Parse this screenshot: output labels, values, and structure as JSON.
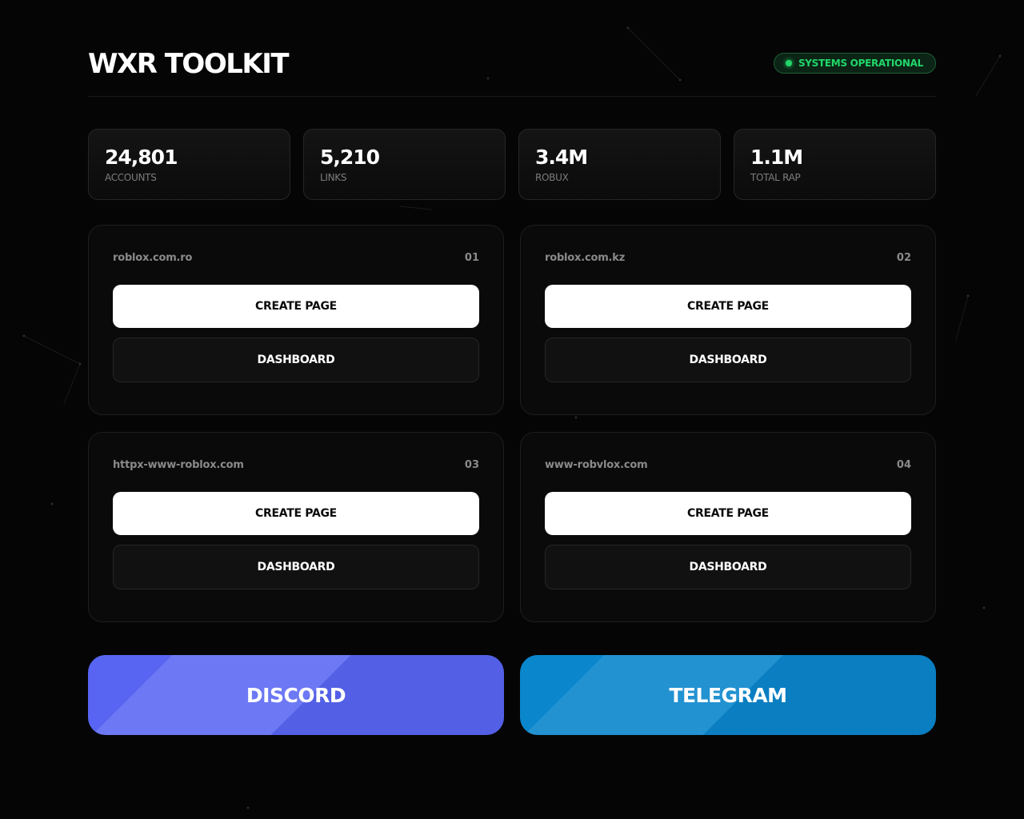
{
  "header": {
    "title": "WXR TOOLKIT",
    "status": "SYSTEMS OPERATIONAL"
  },
  "stats": [
    {
      "value": "24,801",
      "label": "ACCOUNTS"
    },
    {
      "value": "5,210",
      "label": "LINKS"
    },
    {
      "value": "3.4M",
      "label": "ROBUX"
    },
    {
      "value": "1.1M",
      "label": "TOTAL RAP"
    }
  ],
  "domains": [
    {
      "name": "roblox.com.ro",
      "index": "01",
      "create_label": "CREATE PAGE",
      "dashboard_label": "DASHBOARD"
    },
    {
      "name": "roblox.com.kz",
      "index": "02",
      "create_label": "CREATE PAGE",
      "dashboard_label": "DASHBOARD"
    },
    {
      "name": "httpx-www-roblox.com",
      "index": "03",
      "create_label": "CREATE PAGE",
      "dashboard_label": "DASHBOARD"
    },
    {
      "name": "www-robvlox.com",
      "index": "04",
      "create_label": "CREATE PAGE",
      "dashboard_label": "DASHBOARD"
    }
  ],
  "social": {
    "discord_label": "DISCORD",
    "telegram_label": "TELEGRAM"
  },
  "colors": {
    "status_green": "#22d76a",
    "discord": "#5865f2",
    "telegram": "#0a86cc",
    "background": "#050505"
  }
}
